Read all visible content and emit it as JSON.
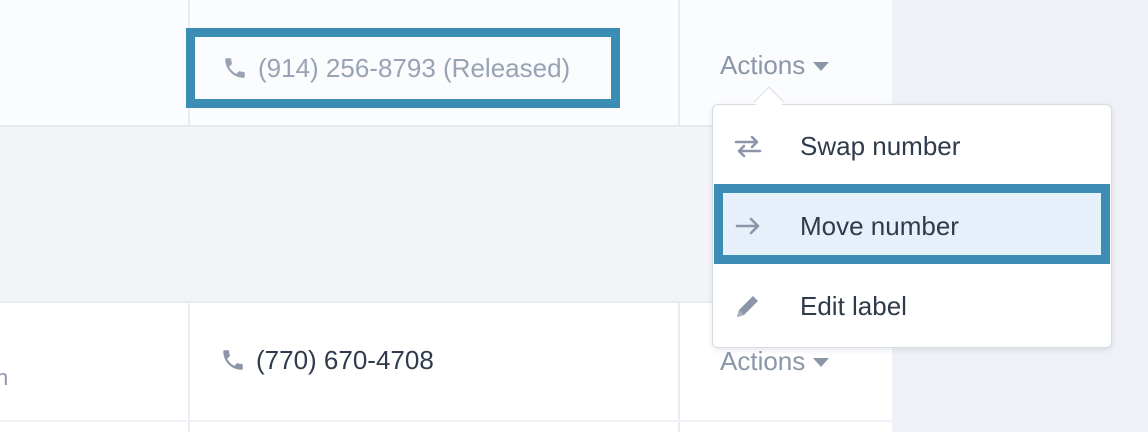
{
  "rows": [
    {
      "phone": "(914) 256-8793 (Released)",
      "status": "released",
      "actions_label": "Actions"
    },
    {
      "phone": "(770) 670-4708",
      "status": "active",
      "actions_label": "Actions",
      "first_col_fragment": "n"
    }
  ],
  "dropdown": {
    "items": [
      {
        "label": "Swap number",
        "icon": "swap-icon"
      },
      {
        "label": "Move number",
        "icon": "arrow-right-icon",
        "highlighted": true
      },
      {
        "label": "Edit label",
        "icon": "pencil-icon"
      }
    ]
  },
  "colors": {
    "highlight_border": "#3b8db3",
    "highlight_fill": "#e6f0fa",
    "muted_text": "#98a3b3",
    "primary_text": "#2f3b4c"
  }
}
